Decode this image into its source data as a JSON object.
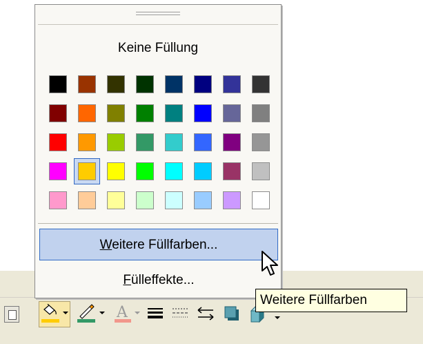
{
  "popup": {
    "no_fill_label": "Keine Füllung",
    "more_colors": {
      "accel": "W",
      "rest": "eitere Füllfarben..."
    },
    "fill_effects": {
      "accel": "F",
      "rest": "ülleffekte..."
    }
  },
  "palette": {
    "selected": {
      "row": 3,
      "col": 1
    },
    "rows": [
      [
        "#000000",
        "#993300",
        "#333300",
        "#003300",
        "#003366",
        "#000080",
        "#333399",
        "#333333"
      ],
      [
        "#800000",
        "#ff6600",
        "#808000",
        "#008000",
        "#008080",
        "#0000ff",
        "#666699",
        "#808080"
      ],
      [
        "#ff0000",
        "#ff9900",
        "#99cc00",
        "#339966",
        "#33cccc",
        "#3366ff",
        "#800080",
        "#969696"
      ],
      [
        "#ff00ff",
        "#ffcc00",
        "#ffff00",
        "#00ff00",
        "#00ffff",
        "#00ccff",
        "#993366",
        "#c0c0c0"
      ],
      [
        "#ff99cc",
        "#ffcc99",
        "#ffff99",
        "#ccffcc",
        "#ccffff",
        "#99ccff",
        "#cc99ff",
        "#ffffff"
      ]
    ]
  },
  "tooltip": {
    "text": "Weitere Füllfarben"
  },
  "toolbar": {
    "fill_color": "#ffcc00",
    "line_color": "#339966",
    "font_color": "#ff0000"
  }
}
